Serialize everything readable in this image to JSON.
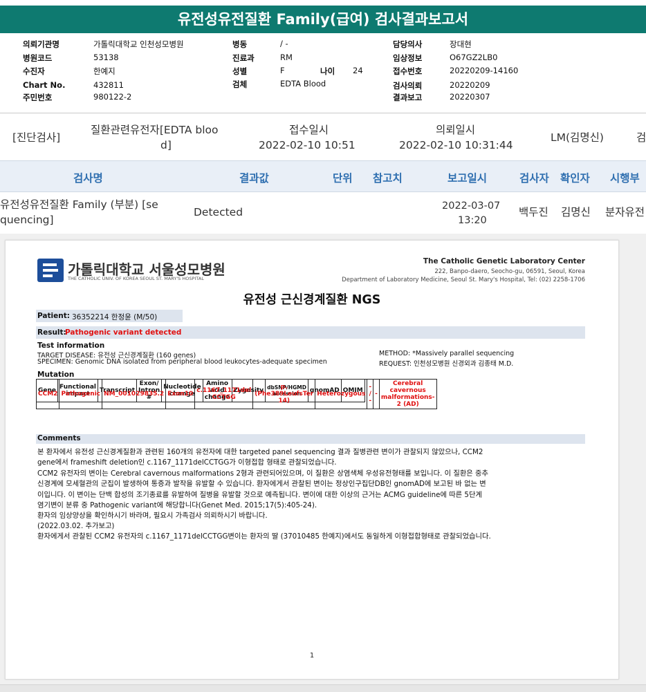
{
  "title": "유전성유전질환 Family(급여) 검사결과보고서",
  "info": {
    "hospital_label": "의뢰기관명",
    "hospital": "가톨릭대학교 인천성모병원",
    "code_label": "병원코드",
    "code": "53138",
    "recipient_label": "수진자",
    "recipient": "한예지",
    "chart_label": "Chart No.",
    "chart": "432811",
    "ssn_label": "주민번호",
    "ssn": "980122-2",
    "ward_label": "병동",
    "ward": "/ -",
    "dept_label": "진료과",
    "dept": "RM",
    "sex_label": "성별",
    "sex": "F",
    "age_label": "나이",
    "age": "24",
    "specimen_label": "검체",
    "specimen": "EDTA Blood",
    "doctor_label": "담당의사",
    "doctor": "장대현",
    "clinical_label": "임상정보",
    "clinical": "O67GZ2LB0",
    "receipt_label": "접수번호",
    "receipt": "20220209-14160",
    "request_label": "검사의뢰",
    "request": "20220209",
    "report_label": "결과보고",
    "report": "20220307"
  },
  "summary_row": {
    "category": "[진단검사]",
    "gene_line1": "질환관련유전자[EDTA bloo",
    "gene_line2": "d]",
    "received_label": "접수일시",
    "received": "2022-02-10  10:51",
    "requested_label": "의뢰일시",
    "requested": "2022-02-10  10:31:44",
    "lm": "LM(김명신)",
    "cut": "검"
  },
  "columns": {
    "name": "검사명",
    "result": "결과값",
    "unit": "단위",
    "ref": "참고치",
    "date": "보고일시",
    "tester": "검사자",
    "confirmer": "확인자",
    "dept": "시행부"
  },
  "result_row": {
    "name_line1": "유전성유전질환 Family (부분) [se",
    "name_line2": "quencing]",
    "result": "Detected",
    "date_line1": "2022-03-07",
    "date_line2": "13:20",
    "tester": "백두진",
    "confirmer": "김명신",
    "dept": "분자유전"
  },
  "doc": {
    "hospital": "가톨릭대학교 서울성모병원",
    "hospital_sub": "THE CATHOLIC UNIV. OF KOREA SEOUL ST. MARY'S HOSPITAL",
    "lab_name": "The Catholic Genetic Laboratory Center",
    "lab_addr": "222, Banpo-daero, Seocho-gu, 06591, Seoul, Korea",
    "lab_dept": "Department of Laboratory Medicine, Seoul St. Mary's Hospital, Tel: (02) 2258-1706",
    "title": "유전성 근신경계질환 NGS",
    "patient_label": "Patient:",
    "patient": "36352214 한정윤 (M/50)",
    "result_label": "Result:",
    "result": "Pathogenic variant detected",
    "test_info": "Test information",
    "target": "TARGET DISEASE: 유전성 근신경계질환 (160 genes)",
    "specimen": "SPECIMEN: Genomic DNA isolated from peripheral blood leukocytes-adequate specimen",
    "method": "METHOD: *Massively parallel sequencing",
    "request": "REQUEST: 인천성모병원 신경외과 김종태 M.D.",
    "mutation": "Mutation",
    "headers": [
      "Gene",
      "Functional impact",
      "Transcript",
      "Exon/ Intron #",
      "Nucleotide change",
      "Amino acid change",
      "Zygosity",
      "dbSNP/HGMD accession",
      "gnomAD",
      "OMIM"
    ],
    "row": [
      "CCM2",
      "Pathogenic",
      "NM_001029835.2",
      "Exon10",
      "c.1167_1171del CCTGG",
      "p.(Phe389LeufsTer 14)",
      "Heterozygous",
      "- / -",
      "-",
      "Cerebral cavernous malformations-2 (AD)"
    ],
    "comments": "Comments",
    "lines": [
      "본 환자에서 유전성 근신경계질환과 관련된 160개의 유전자에 대한 targeted panel sequencing 결과 질병관련 변이가 관찰되지 않았으나, CCM2",
      "gene에서 frameshift deletion인 c.1167_1171delCCTGG가 이형접합 형태로 관찰되었습니다.",
      "CCM2 유전자의 변이는 Cerebral cavernous malformations 2형과 관련되어있으며, 이 질환은 상염색체 우성유전형태를 보입니다. 이 질환은 중추",
      "신경계에 모세혈관의 군집이 발생하여 통증과 발작을 유발할 수 있습니다. 환자에게서 관찰된 변이는 정상인구집단DB인 gnomAD에 보고된 바 없는 변",
      "이입니다. 이 변이는 단백 합성의 조기종료를 유발하여 질병을 유발할 것으로 예측됩니다. 변이에 대한 이상의 근거는 ACMG guideline에 따른 5단계",
      "염기변이 분류 중 Pathogenic variant에 해당합니다(Genet Med. 2015;17(5):405-24).",
      "환자의 임상양상을 확인하시기 바라며, 필요시 가족검사 의뢰하시기 바랍니다.",
      "(2022.03.02. 추가보고)",
      "환자에게서 관찰된 CCM2 유전자의 c.1167_1171delCCTGG변이는 환자의 딸 (37010485 한예지)에서도 동일하게 이형접합형태로 관찰되었습니다."
    ],
    "page": "1"
  }
}
